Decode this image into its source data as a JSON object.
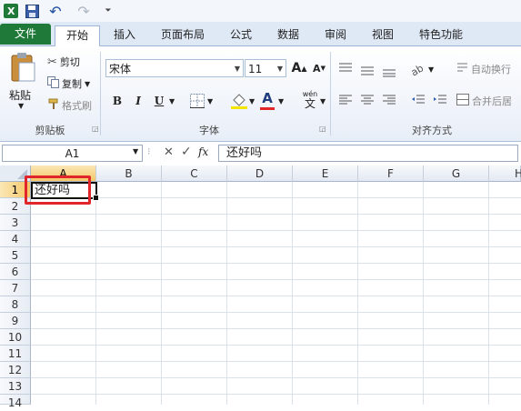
{
  "qat": {
    "undo": "↶",
    "redo": "↷",
    "customize": "⏷"
  },
  "tabs": [
    "文件",
    "开始",
    "插入",
    "页面布局",
    "公式",
    "数据",
    "审阅",
    "视图",
    "特色功能"
  ],
  "clipboard": {
    "paste": "粘贴",
    "cut": "剪切",
    "copy": "复制",
    "format_painter": "格式刷",
    "group": "剪贴板"
  },
  "font": {
    "name": "宋体",
    "size": "11",
    "group": "字体",
    "bold": "B",
    "italic": "I",
    "underline": "U",
    "font_color": "A",
    "grow": "A",
    "shrink": "A",
    "wen": "wén",
    "wen_char": "文"
  },
  "alignment": {
    "wrap_text": "自动换行",
    "merge_center": "合并后居",
    "group": "对齐方式"
  },
  "formula_bar": {
    "name_box": "A1",
    "fx": "fx",
    "content": "还好吗"
  },
  "grid": {
    "columns": [
      "A",
      "B",
      "C",
      "D",
      "E",
      "F",
      "G",
      "H"
    ],
    "rows": [
      "1",
      "2",
      "3",
      "4",
      "5",
      "6",
      "7",
      "8",
      "9",
      "10",
      "11",
      "12",
      "13",
      "14"
    ],
    "active_cell": "A1",
    "cell_a1": "还好吗"
  },
  "colors": {
    "file_tab": "#1f7a3a",
    "selection_header": "#f4c766",
    "highlight_box": "#e0262b"
  }
}
